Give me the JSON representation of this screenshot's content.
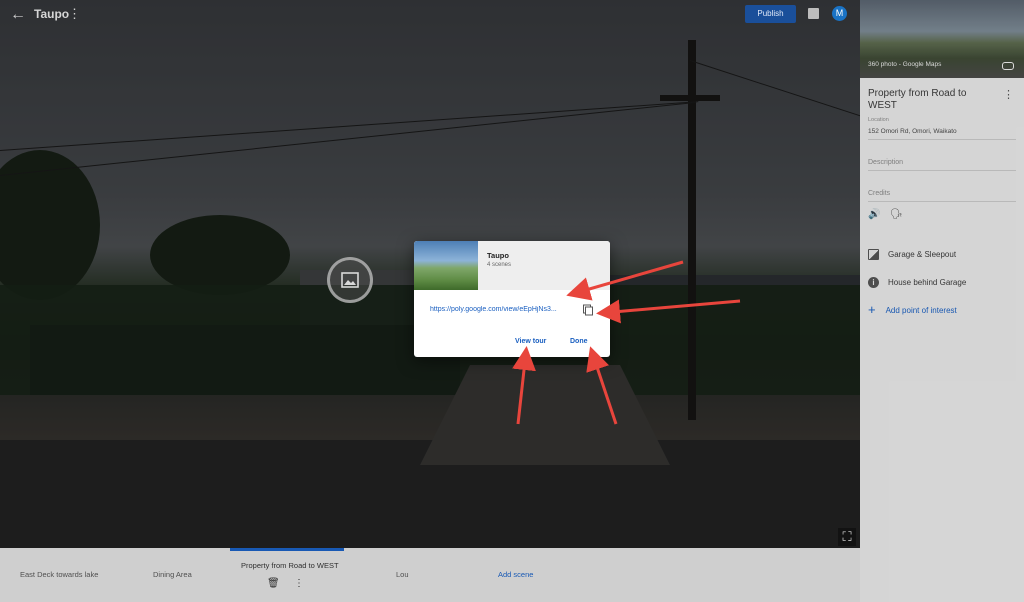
{
  "topbar": {
    "title": "Taupo",
    "publish_label": "Publish",
    "avatar_letter": "M"
  },
  "panel": {
    "thumb_caption": "360 photo - Google Maps",
    "scene_name": "Property from Road to WEST",
    "location_label": "Location",
    "location_value": "152 Omori Rd, Omori, Waikato",
    "description_label": "Description",
    "credits_label": "Credits",
    "points_of_interest": [
      {
        "label": "Garage & Sleepout",
        "icon": "image-icon"
      },
      {
        "label": "House behind Garage",
        "icon": "info-icon"
      }
    ],
    "add_poi_label": "Add point of interest"
  },
  "strip": {
    "scenes": [
      "East Deck towards lake",
      "Dining Area",
      "Property from Road to WEST",
      "Lou"
    ],
    "active_index": 2,
    "add_scene_label": "Add scene"
  },
  "dialog": {
    "title": "Taupo",
    "subtitle": "4 scenes",
    "link": "https://poly.google.com/view/eEpHjNs3...",
    "view_tour_label": "View tour",
    "done_label": "Done"
  },
  "colors": {
    "accent": "#1a5fc0",
    "publish_bg": "#1a4f9a",
    "annotation_arrow": "#e8453c"
  }
}
